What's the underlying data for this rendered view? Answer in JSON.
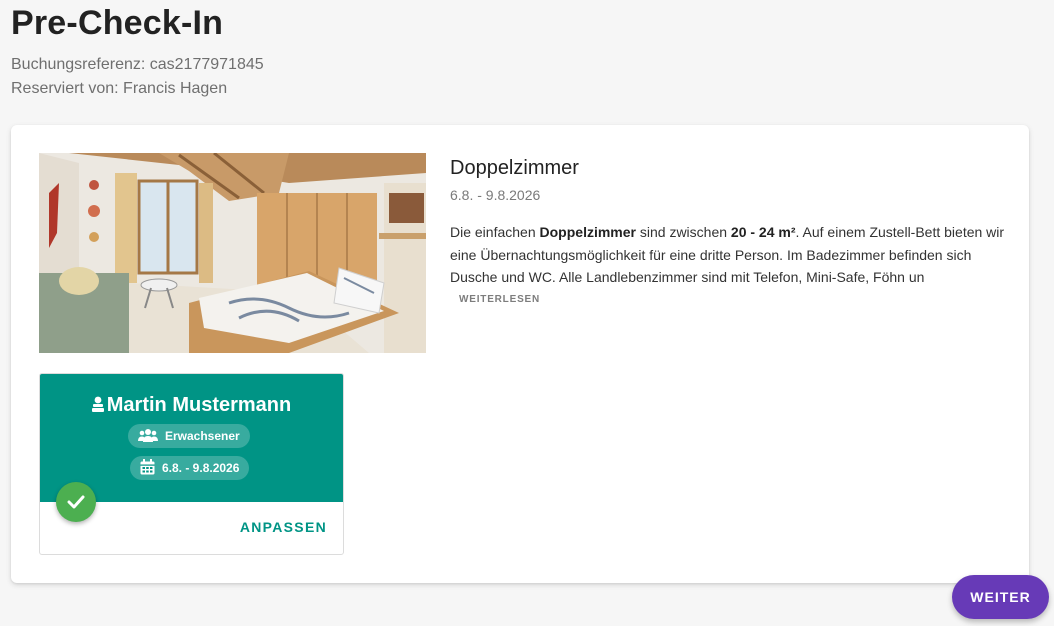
{
  "page": {
    "title": "Pre-Check-In",
    "booking_reference": "Buchungsreferenz: cas2177971845",
    "reserved_by": "Reserviert von: Francis Hagen"
  },
  "room": {
    "title": "Doppelzimmer",
    "dates": "6.8. - 9.8.2026",
    "description_parts": {
      "p1": "Die einfachen ",
      "b1": "Doppelzimmer",
      "p2": " sind zwischen ",
      "b2": "20 - 24 m²",
      "p3": ". Auf einem Zustell-Bett bieten wir eine Übernachtungsmöglichkeit für eine dritte Person. Im Badezimmer befinden sich Dusche und WC. Alle Landlebenzimmer sind mit Telefon, Mini-Safe, Föhn un"
    },
    "read_more_label": "WEITERLESEN"
  },
  "guest": {
    "name": "Martin Mustermann",
    "type": "Erwachsener",
    "dates": "6.8. - 9.8.2026",
    "adjust_label": "ANPASSEN",
    "status_icon": "check-icon"
  },
  "footer": {
    "next_label": "WEITER"
  },
  "colors": {
    "teal": "#009485",
    "purple": "#673ab7",
    "green": "#4caf50"
  }
}
